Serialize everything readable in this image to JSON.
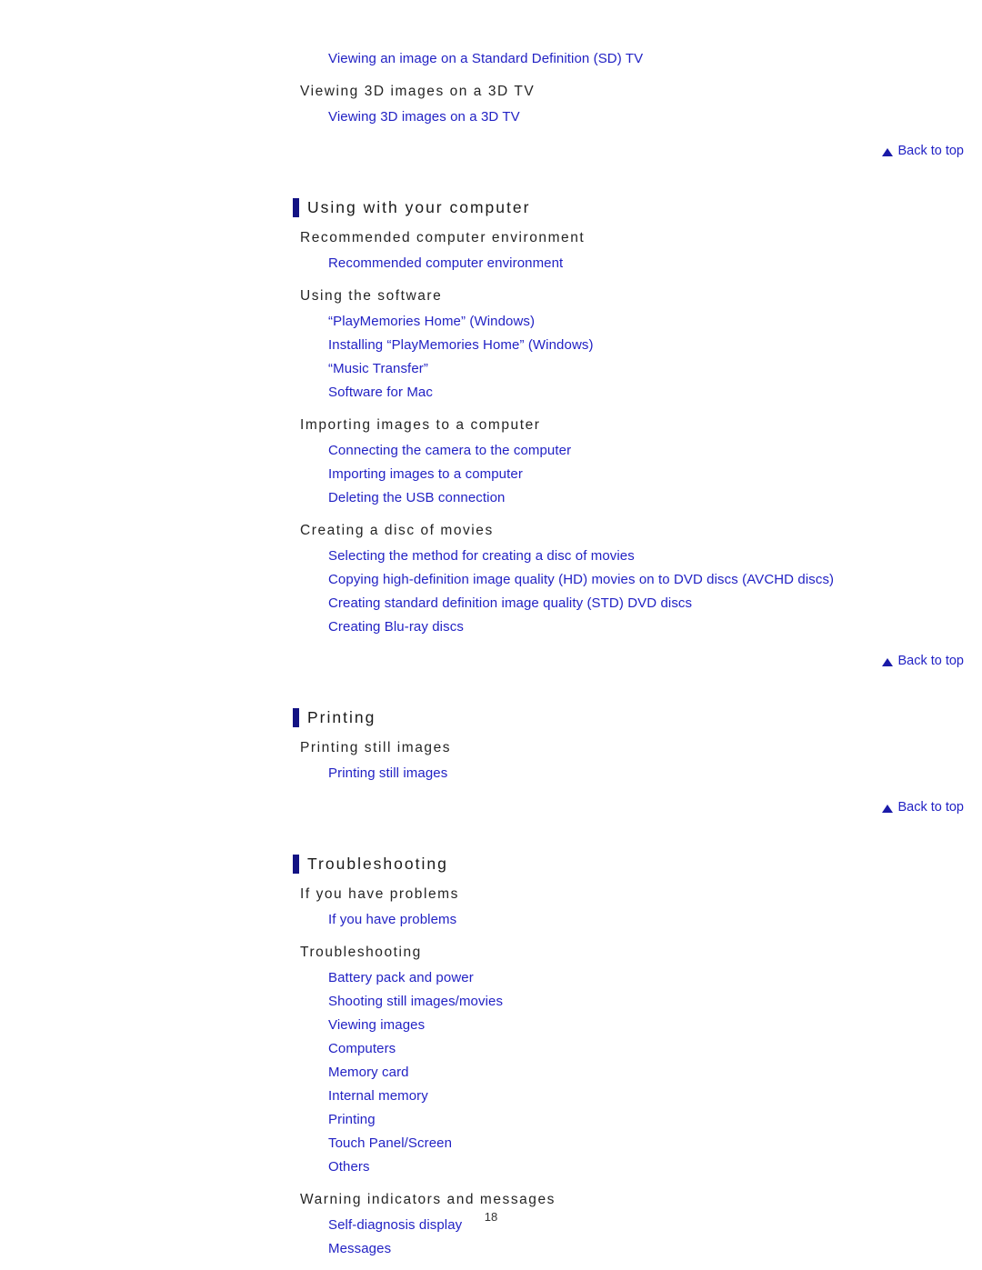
{
  "page": {
    "number": "18",
    "back_to_top_label": "Back to top",
    "accent_color": "#131384",
    "link_color": "#2222c4",
    "heading_color": "#242424"
  },
  "top_links": [
    {
      "label": "Viewing an image on a Standard Definition (SD) TV"
    }
  ],
  "top_heading": {
    "label": "Viewing 3D images on a 3D TV",
    "links": [
      {
        "label": "Viewing 3D images on a 3D TV"
      }
    ]
  },
  "sections": [
    {
      "title": "Using with your computer",
      "groups": [
        {
          "heading": "Recommended computer environment",
          "links": [
            {
              "label": "Recommended computer environment"
            }
          ]
        },
        {
          "heading": "Using the software",
          "links": [
            {
              "label": "“PlayMemories Home” (Windows)"
            },
            {
              "label": "Installing “PlayMemories Home” (Windows)"
            },
            {
              "label": "“Music Transfer”"
            },
            {
              "label": "Software for Mac"
            }
          ]
        },
        {
          "heading": "Importing images to a computer",
          "links": [
            {
              "label": "Connecting the camera to the computer"
            },
            {
              "label": "Importing images to a computer"
            },
            {
              "label": "Deleting the USB connection"
            }
          ]
        },
        {
          "heading": "Creating a disc of movies",
          "links": [
            {
              "label": "Selecting the method for creating a disc of movies"
            },
            {
              "label": "Copying high-definition image quality (HD) movies on to DVD discs (AVCHD discs)"
            },
            {
              "label": "Creating standard definition image quality (STD) DVD discs"
            },
            {
              "label": "Creating Blu-ray discs"
            }
          ]
        }
      ]
    },
    {
      "title": "Printing",
      "groups": [
        {
          "heading": "Printing still images",
          "links": [
            {
              "label": "Printing still images"
            }
          ]
        }
      ]
    },
    {
      "title": "Troubleshooting",
      "groups": [
        {
          "heading": "If you have problems",
          "links": [
            {
              "label": "If you have problems"
            }
          ]
        },
        {
          "heading": "Troubleshooting",
          "links": [
            {
              "label": "Battery pack and power"
            },
            {
              "label": "Shooting still images/movies"
            },
            {
              "label": "Viewing images"
            },
            {
              "label": "Computers"
            },
            {
              "label": "Memory card"
            },
            {
              "label": "Internal memory"
            },
            {
              "label": "Printing"
            },
            {
              "label": "Touch Panel/Screen"
            },
            {
              "label": "Others"
            }
          ]
        },
        {
          "heading": "Warning indicators and messages",
          "links": [
            {
              "label": "Self-diagnosis display"
            },
            {
              "label": "Messages"
            }
          ]
        }
      ]
    }
  ]
}
